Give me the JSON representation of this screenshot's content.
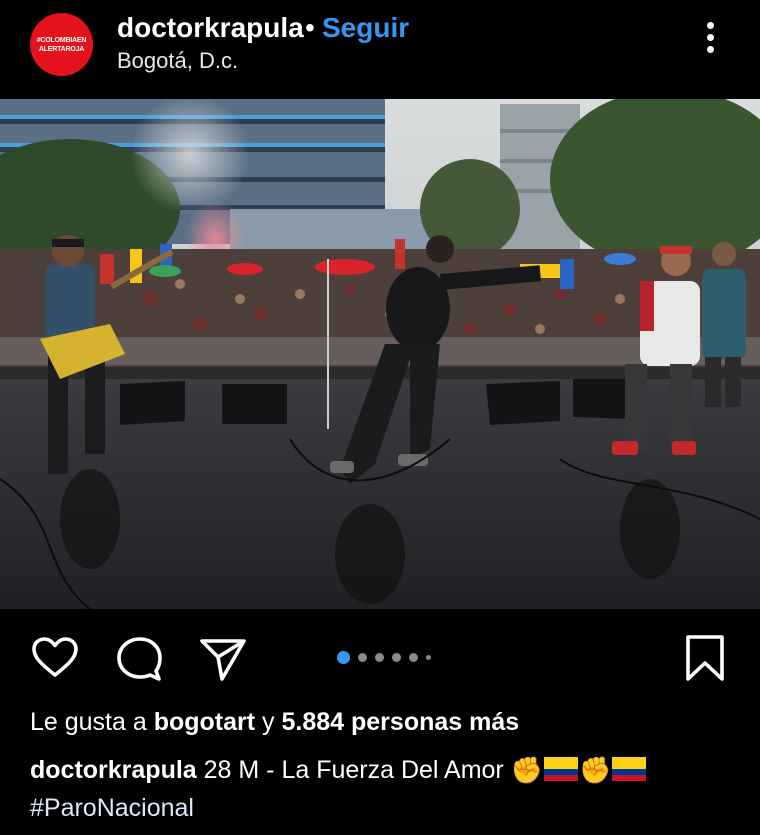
{
  "header": {
    "avatar_text_1": "#COLOMBIAEN",
    "avatar_text_2": "ALERTAROJA",
    "username": "doctorkrapula",
    "separator": "•",
    "follow_label": "Seguir",
    "location": "Bogotá, D.c."
  },
  "carousel": {
    "count": 6,
    "active_index": 0
  },
  "likes": {
    "prefix": "Le gusta a ",
    "user": "bogotart",
    "middle": " y ",
    "count": "5.884 personas más"
  },
  "caption": {
    "username": "doctorkrapula",
    "text": " 28 M - La Fuerza Del Amor ",
    "emoji_fist": "✊",
    "hashtag": "#ParoNacional"
  },
  "colors": {
    "accent": "#3797f0",
    "background": "#000000",
    "avatar": "#e3121d"
  },
  "icons": [
    "heart-icon",
    "comment-icon",
    "share-icon",
    "bookmark-icon",
    "more-options-icon"
  ]
}
